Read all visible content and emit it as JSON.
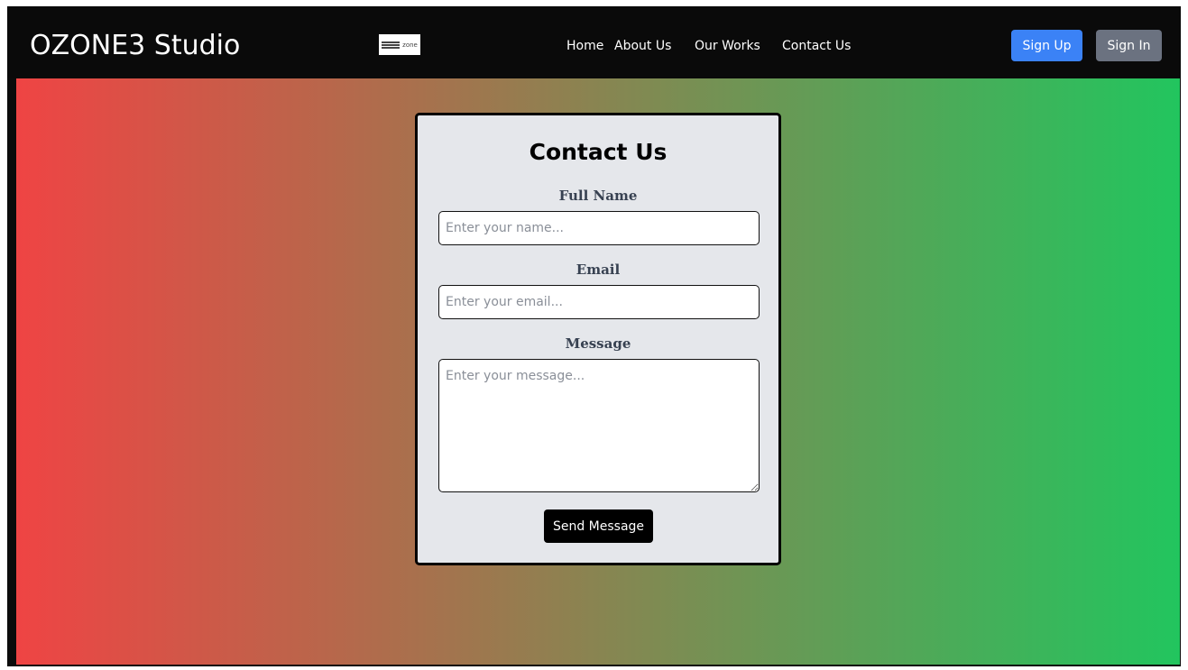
{
  "navbar": {
    "brand": "OZONE3 Studio",
    "logo_text": "zone",
    "links": [
      {
        "label": "Home"
      },
      {
        "label": "About Us"
      },
      {
        "label": "Our Works"
      },
      {
        "label": "Contact Us"
      }
    ],
    "signup_label": "Sign Up",
    "signin_label": "Sign In"
  },
  "colors": {
    "gradient_start": "#ef4444",
    "gradient_end": "#22c55e",
    "signup_bg": "#3b82f6",
    "signin_bg": "#6b7280",
    "card_bg": "#e5e7eb"
  },
  "contact_form": {
    "title": "Contact Us",
    "name_label": "Full Name",
    "name_placeholder": "Enter your name...",
    "name_value": "",
    "email_label": "Email",
    "email_placeholder": "Enter your email...",
    "email_value": "",
    "message_label": "Message",
    "message_placeholder": "Enter your message...",
    "message_value": "",
    "submit_label": "Send Message"
  }
}
